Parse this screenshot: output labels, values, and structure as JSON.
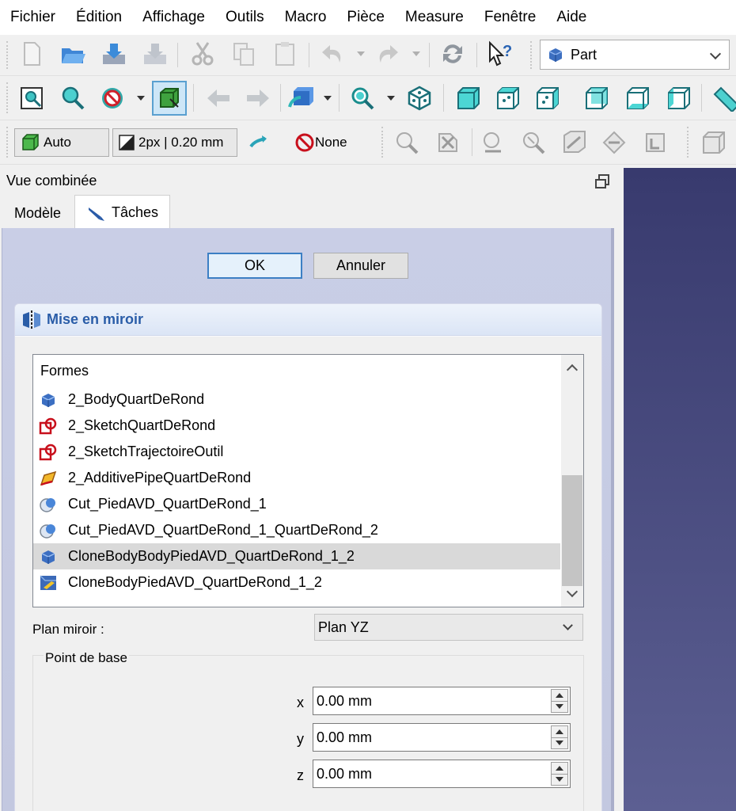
{
  "menu": [
    "Fichier",
    "Édition",
    "Affichage",
    "Outils",
    "Macro",
    "Pièce",
    "Measure",
    "Fenêtre",
    "Aide"
  ],
  "toolbar": {
    "workbench": "Part",
    "draw_style": "Auto",
    "line_width": "2px | 0.20 mm",
    "snap": "None"
  },
  "panel": {
    "title": "Vue combinée",
    "tabs": [
      "Modèle",
      "Tâches"
    ],
    "ok_label": "OK",
    "cancel_label": "Annuler"
  },
  "mirror": {
    "title": "Mise en miroir",
    "list_header": "Formes",
    "items": [
      {
        "label": "2_BodyQuartDeRond",
        "icon": "body-icon"
      },
      {
        "label": "2_SketchQuartDeRond",
        "icon": "sketch-icon"
      },
      {
        "label": "2_SketchTrajectoireOutil",
        "icon": "sketch-icon"
      },
      {
        "label": "2_AdditivePipeQuartDeRond",
        "icon": "additive-pipe-icon"
      },
      {
        "label": "Cut_PiedAVD_QuartDeRond_1",
        "icon": "cut-icon"
      },
      {
        "label": "Cut_PiedAVD_QuartDeRond_1_QuartDeRond_2",
        "icon": "cut-icon"
      },
      {
        "label": "CloneBodyBodyPiedAVD_QuartDeRond_1_2",
        "icon": "body-icon",
        "selected": true
      },
      {
        "label": "CloneBodyPiedAVD_QuartDeRond_1_2",
        "icon": "clone-icon"
      }
    ],
    "plane_label": "Plan miroir :",
    "plane_value": "Plan YZ",
    "base_point_title": "Point de base",
    "x_label": "x",
    "x_value": "0.00 mm",
    "y_label": "y",
    "y_value": "0.00 mm",
    "z_label": "z",
    "z_value": "0.00 mm"
  }
}
